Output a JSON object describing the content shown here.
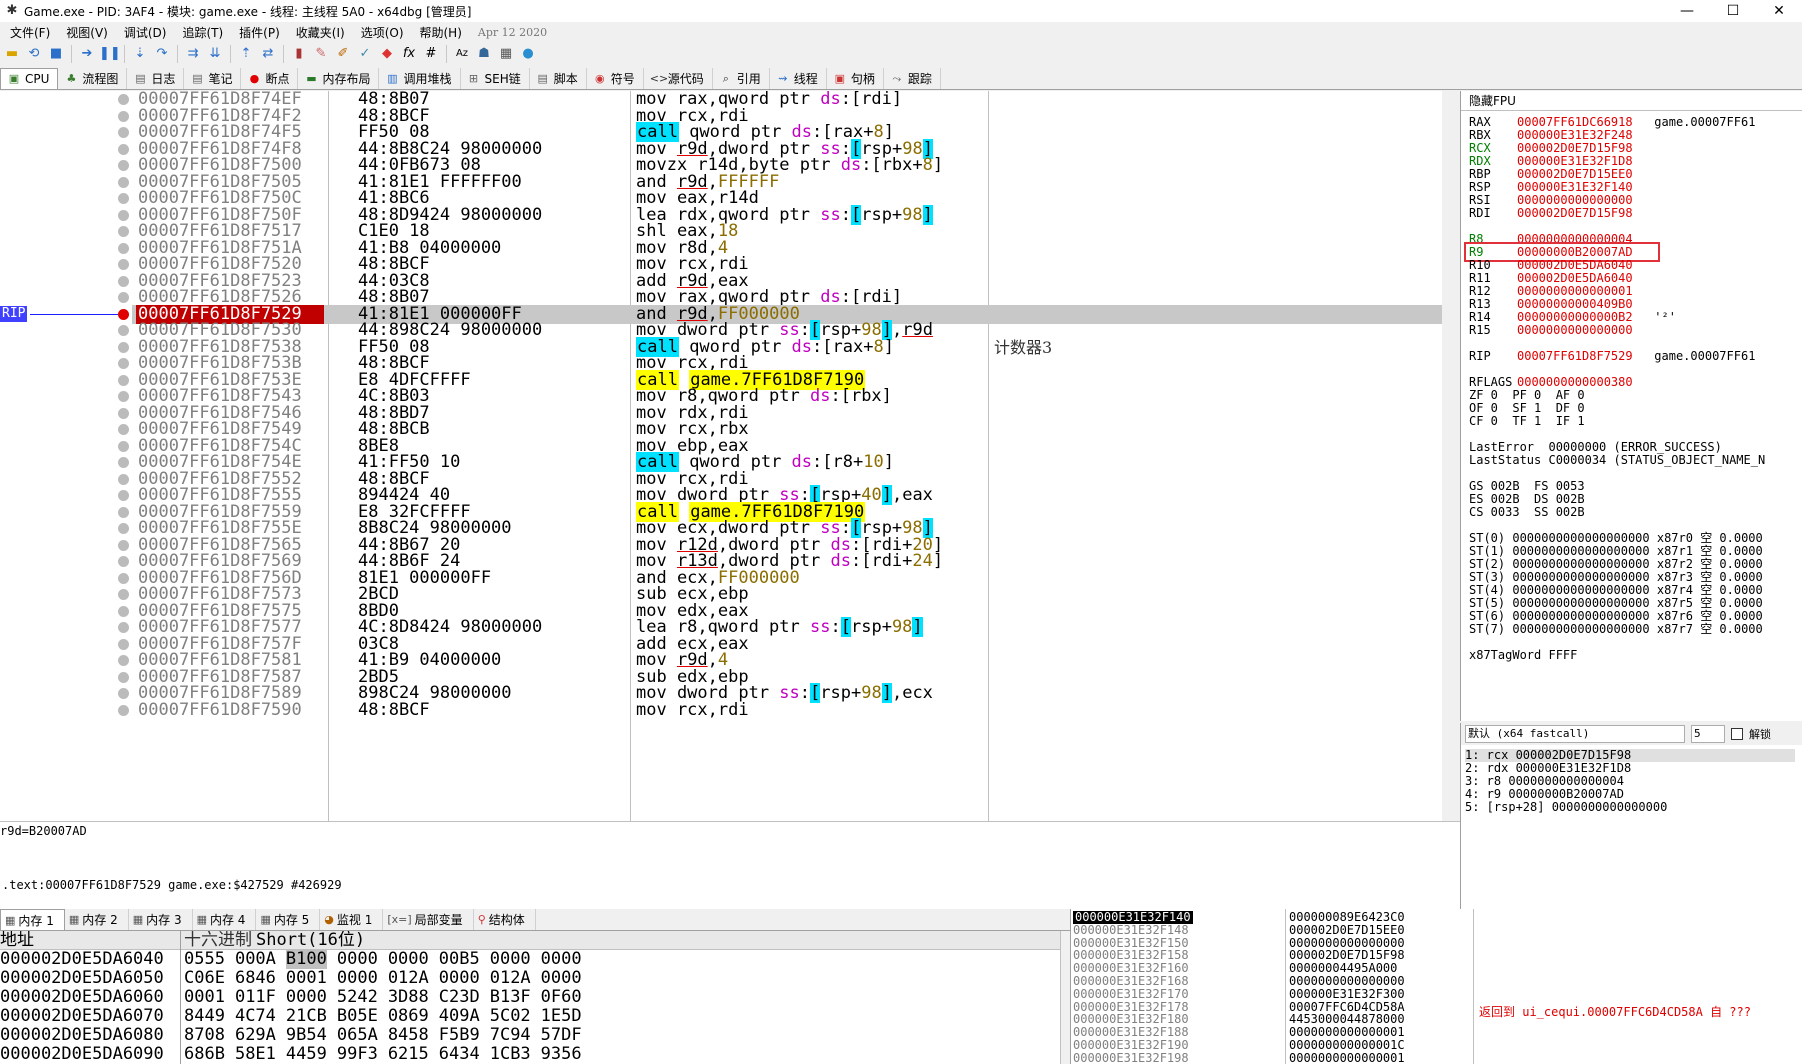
{
  "window": {
    "title": "Game.exe - PID: 3AF4 - 模块: game.exe - 线程: 主线程 5A0 - x64dbg [管理员]"
  },
  "menu": {
    "items": [
      "文件(F)",
      "视图(V)",
      "调试(D)",
      "追踪(T)",
      "插件(P)",
      "收藏夹(I)",
      "选项(O)",
      "帮助(H)"
    ],
    "date": "Apr 12 2020"
  },
  "tabs": [
    "CPU",
    "流程图",
    "日志",
    "笔记",
    "断点",
    "内存布局",
    "调用堆栈",
    "SEH链",
    "脚本",
    "符号",
    "源代码",
    "引用",
    "线程",
    "句柄",
    "跟踪"
  ],
  "disasm": {
    "rip_label": "RIP",
    "rows": [
      {
        "addr": "00007FF61D8F74EF",
        "bytes": "48:8B07",
        "instr": "mov rax,qword ptr ds:[rdi]",
        "cmt": ""
      },
      {
        "addr": "00007FF61D8F74F2",
        "bytes": "48:8BCF",
        "instr": "mov rcx,rdi",
        "cmt": ""
      },
      {
        "addr": "00007FF61D8F74F5",
        "bytes": "FF50 08",
        "instr": "call qword ptr ds:[rax+8]",
        "cmt": ""
      },
      {
        "addr": "00007FF61D8F74F8",
        "bytes": "44:8B8C24 98000000",
        "instr": "mov r9d,dword ptr ss:[rsp+98]",
        "cmt": ""
      },
      {
        "addr": "00007FF61D8F7500",
        "bytes": "44:0FB673 08",
        "instr": "movzx r14d,byte ptr ds:[rbx+8]",
        "cmt": ""
      },
      {
        "addr": "00007FF61D8F7505",
        "bytes": "41:81E1 FFFFFF00",
        "instr": "and r9d,FFFFFF",
        "cmt": ""
      },
      {
        "addr": "00007FF61D8F750C",
        "bytes": "41:8BC6",
        "instr": "mov eax,r14d",
        "cmt": ""
      },
      {
        "addr": "00007FF61D8F750F",
        "bytes": "48:8D9424 98000000",
        "instr": "lea rdx,qword ptr ss:[rsp+98]",
        "cmt": ""
      },
      {
        "addr": "00007FF61D8F7517",
        "bytes": "C1E0 18",
        "instr": "shl eax,18",
        "cmt": ""
      },
      {
        "addr": "00007FF61D8F751A",
        "bytes": "41:B8 04000000",
        "instr": "mov r8d,4",
        "cmt": ""
      },
      {
        "addr": "00007FF61D8F7520",
        "bytes": "48:8BCF",
        "instr": "mov rcx,rdi",
        "cmt": ""
      },
      {
        "addr": "00007FF61D8F7523",
        "bytes": "44:03C8",
        "instr": "add r9d,eax",
        "cmt": ""
      },
      {
        "addr": "00007FF61D8F7526",
        "bytes": "48:8B07",
        "instr": "mov rax,qword ptr ds:[rdi]",
        "cmt": ""
      },
      {
        "addr": "00007FF61D8F7529",
        "bytes": "41:81E1 000000FF",
        "instr": "and r9d,FF000000",
        "cmt": ""
      },
      {
        "addr": "00007FF61D8F7530",
        "bytes": "44:898C24 98000000",
        "instr": "mov dword ptr ss:[rsp+98],r9d",
        "cmt": ""
      },
      {
        "addr": "00007FF61D8F7538",
        "bytes": "FF50 08",
        "instr": "call qword ptr ds:[rax+8]",
        "cmt": "计数器3"
      },
      {
        "addr": "00007FF61D8F753B",
        "bytes": "48:8BCF",
        "instr": "mov rcx,rdi",
        "cmt": ""
      },
      {
        "addr": "00007FF61D8F753E",
        "bytes": "E8 4DFCFFFF",
        "instr": "call game.7FF61D8F7190",
        "cmt": ""
      },
      {
        "addr": "00007FF61D8F7543",
        "bytes": "4C:8B03",
        "instr": "mov r8,qword ptr ds:[rbx]",
        "cmt": ""
      },
      {
        "addr": "00007FF61D8F7546",
        "bytes": "48:8BD7",
        "instr": "mov rdx,rdi",
        "cmt": ""
      },
      {
        "addr": "00007FF61D8F7549",
        "bytes": "48:8BCB",
        "instr": "mov rcx,rbx",
        "cmt": ""
      },
      {
        "addr": "00007FF61D8F754C",
        "bytes": "8BE8",
        "instr": "mov ebp,eax",
        "cmt": ""
      },
      {
        "addr": "00007FF61D8F754E",
        "bytes": "41:FF50 10",
        "instr": "call qword ptr ds:[r8+10]",
        "cmt": ""
      },
      {
        "addr": "00007FF61D8F7552",
        "bytes": "48:8BCF",
        "instr": "mov rcx,rdi",
        "cmt": ""
      },
      {
        "addr": "00007FF61D8F7555",
        "bytes": "894424 40",
        "instr": "mov dword ptr ss:[rsp+40],eax",
        "cmt": ""
      },
      {
        "addr": "00007FF61D8F7559",
        "bytes": "E8 32FCFFFF",
        "instr": "call game.7FF61D8F7190",
        "cmt": ""
      },
      {
        "addr": "00007FF61D8F755E",
        "bytes": "8B8C24 98000000",
        "instr": "mov ecx,dword ptr ss:[rsp+98]",
        "cmt": ""
      },
      {
        "addr": "00007FF61D8F7565",
        "bytes": "44:8B67 20",
        "instr": "mov r12d,dword ptr ds:[rdi+20]",
        "cmt": ""
      },
      {
        "addr": "00007FF61D8F7569",
        "bytes": "44:8B6F 24",
        "instr": "mov r13d,dword ptr ds:[rdi+24]",
        "cmt": ""
      },
      {
        "addr": "00007FF61D8F756D",
        "bytes": "81E1 000000FF",
        "instr": "and ecx,FF000000",
        "cmt": ""
      },
      {
        "addr": "00007FF61D8F7573",
        "bytes": "2BCD",
        "instr": "sub ecx,ebp",
        "cmt": ""
      },
      {
        "addr": "00007FF61D8F7575",
        "bytes": "8BD0",
        "instr": "mov edx,eax",
        "cmt": ""
      },
      {
        "addr": "00007FF61D8F7577",
        "bytes": "4C:8D8424 98000000",
        "instr": "lea r8,qword ptr ss:[rsp+98]",
        "cmt": ""
      },
      {
        "addr": "00007FF61D8F757F",
        "bytes": "03C8",
        "instr": "add ecx,eax",
        "cmt": ""
      },
      {
        "addr": "00007FF61D8F7581",
        "bytes": "41:B9 04000000",
        "instr": "mov r9d,4",
        "cmt": ""
      },
      {
        "addr": "00007FF61D8F7587",
        "bytes": "2BD5",
        "instr": "sub edx,ebp",
        "cmt": ""
      },
      {
        "addr": "00007FF61D8F7589",
        "bytes": "898C24 98000000",
        "instr": "mov dword ptr ss:[rsp+98],ecx",
        "cmt": ""
      },
      {
        "addr": "00007FF61D8F7590",
        "bytes": "48:8BCF",
        "instr": "mov rcx,rdi",
        "cmt": ""
      }
    ]
  },
  "info": {
    "line1": "r9d=B20007AD",
    "line2": ".text:00007FF61D8F7529 game.exe:$427529 #426929"
  },
  "registers": {
    "header": "隐藏FPU",
    "general": [
      {
        "name": "RAX",
        "value": "00007FF61DC66918",
        "comment": "game.00007FF61"
      },
      {
        "name": "RBX",
        "value": "000000E31E32F248",
        "comment": ""
      },
      {
        "name": "RCX",
        "value": "000002D0E7D15F98",
        "comment": ""
      },
      {
        "name": "RDX",
        "value": "000000E31E32F1D8",
        "comment": ""
      },
      {
        "name": "RBP",
        "value": "000002D0E7D15EE0",
        "comment": ""
      },
      {
        "name": "RSP",
        "value": "000000E31E32F140",
        "comment": ""
      },
      {
        "name": "RSI",
        "value": "0000000000000000",
        "comment": ""
      },
      {
        "name": "RDI",
        "value": "000002D0E7D15F98",
        "comment": ""
      }
    ],
    "extended": [
      {
        "name": "R8",
        "value": "0000000000000004",
        "comment": ""
      },
      {
        "name": "R9",
        "value": "00000000B20007AD",
        "comment": ""
      },
      {
        "name": "R10",
        "value": "000002D0E5DA6040",
        "comment": ""
      },
      {
        "name": "R11",
        "value": "000002D0E5DA6040",
        "comment": ""
      },
      {
        "name": "R12",
        "value": "0000000000000001",
        "comment": ""
      },
      {
        "name": "R13",
        "value": "00000000000409B0",
        "comment": ""
      },
      {
        "name": "R14",
        "value": "00000000000000B2",
        "comment": "'²'"
      },
      {
        "name": "R15",
        "value": "0000000000000000",
        "comment": ""
      }
    ],
    "rip": {
      "name": "RIP",
      "value": "00007FF61D8F7529",
      "comment": "game.00007FF61"
    },
    "rflags": {
      "name": "RFLAGS",
      "value": "0000000000000380"
    },
    "flags_line1": "ZF 0  PF 0  AF 0",
    "flags_line2": "OF 0  SF 1  DF 0",
    "flags_line3": "CF 0  TF 1  IF 1",
    "last_error": "LastError  00000000 (ERROR_SUCCESS)",
    "last_status": "LastStatus C0000034 (STATUS_OBJECT_NAME_N",
    "seg1": "GS 002B  FS 0053",
    "seg2": "ES 002B  DS 002B",
    "seg3": "CS 0033  SS 002B",
    "fpu": [
      "ST(0) 0000000000000000000 x87r0 空 0.0000",
      "ST(1) 0000000000000000000 x87r1 空 0.0000",
      "ST(2) 0000000000000000000 x87r2 空 0.0000",
      "ST(3) 0000000000000000000 x87r3 空 0.0000",
      "ST(4) 0000000000000000000 x87r4 空 0.0000",
      "ST(5) 0000000000000000000 x87r5 空 0.0000",
      "ST(6) 0000000000000000000 x87r6 空 0.0000",
      "ST(7) 0000000000000000000 x87r7 空 0.0000"
    ],
    "tagword": "x87TagWord FFFF"
  },
  "callconv": {
    "select_value": "默认 (x64 fastcall)",
    "spin_value": "5",
    "unlock_label": "解锁",
    "args": [
      "1: rcx 000002D0E7D15F98",
      "2: rdx 000000E31E32F1D8",
      "3: r8 0000000000000004",
      "4: r9 00000000B20007AD",
      "5: [rsp+28] 0000000000000000"
    ]
  },
  "bottom_tabs": [
    "内存 1",
    "内存 2",
    "内存 3",
    "内存 4",
    "内存 5",
    "监视 1",
    "局部变量",
    "结构体"
  ],
  "dump": {
    "col_addr": "地址",
    "col_hex": "十六进制",
    "col_short": "Short(16位)",
    "rows": [
      {
        "addr": "000002D0E5DA6040",
        "vals": [
          "0555",
          "000A",
          "B100",
          "0000",
          "0000",
          "00B5",
          "0000",
          "0000"
        ]
      },
      {
        "addr": "000002D0E5DA6050",
        "vals": [
          "C06E",
          "6846",
          "0001",
          "0000",
          "012A",
          "0000",
          "012A",
          "0000"
        ]
      },
      {
        "addr": "000002D0E5DA6060",
        "vals": [
          "0001",
          "011F",
          "0000",
          "5242",
          "3D88",
          "C23D",
          "B13F",
          "0F60"
        ]
      },
      {
        "addr": "000002D0E5DA6070",
        "vals": [
          "8449",
          "4C74",
          "21CB",
          "B05E",
          "0869",
          "409A",
          "5C02",
          "1E5D"
        ]
      },
      {
        "addr": "000002D0E5DA6080",
        "vals": [
          "8708",
          "629A",
          "9B54",
          "065A",
          "8458",
          "F5B9",
          "7C94",
          "57DF"
        ]
      },
      {
        "addr": "000002D0E5DA6090",
        "vals": [
          "686B",
          "58E1",
          "4459",
          "99F3",
          "6215",
          "6434",
          "1CB3",
          "9356"
        ]
      }
    ]
  },
  "stack": {
    "rows": [
      {
        "addr": "000000E31E32F140",
        "val": "000000089E6423C0"
      },
      {
        "addr": "000000E31E32F148",
        "val": "000002D0E7D15EE0"
      },
      {
        "addr": "000000E31E32F150",
        "val": "0000000000000000"
      },
      {
        "addr": "000000E31E32F158",
        "val": "000002D0E7D15F98"
      },
      {
        "addr": "000000E31E32F160",
        "val": "00000004495A000"
      },
      {
        "addr": "000000E31E32F168",
        "val": "0000000000000000"
      },
      {
        "addr": "000000E31E32F170",
        "val": "000000E31E32F300"
      },
      {
        "addr": "000000E31E32F178",
        "val": "00007FFC6D4CD58A"
      },
      {
        "addr": "000000E31E32F180",
        "val": "4453000044878000"
      },
      {
        "addr": "000000E31E32F188",
        "val": "0000000000000001"
      },
      {
        "addr": "000000E31E32F190",
        "val": "000000000000001C"
      },
      {
        "addr": "000000E31E32F198",
        "val": "0000000000000001"
      }
    ],
    "comment": "返回到 ui_cequi.00007FFC6D4CD58A 自 ???"
  }
}
